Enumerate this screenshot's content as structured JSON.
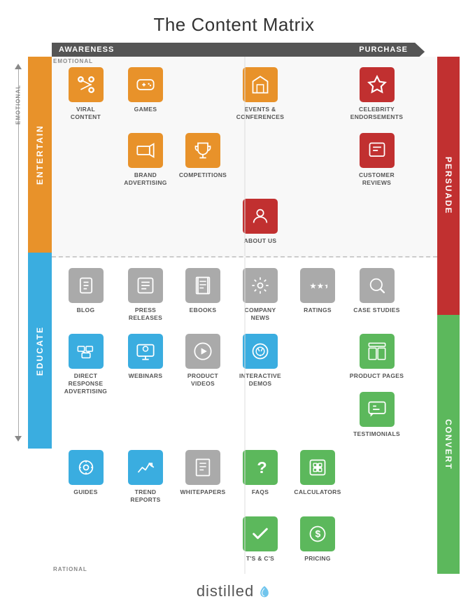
{
  "title": "The Content Matrix",
  "top_axis": {
    "left": "AWARENESS",
    "right": "PURCHASE"
  },
  "left_labels": {
    "top": "ENTERTAIN",
    "bottom": "EDUCATE"
  },
  "right_labels": {
    "top": "PERSUADE",
    "bottom": "CONVERT"
  },
  "vertical_axis": {
    "top": "EMOTIONAL",
    "bottom": "RATIONAL"
  },
  "top_items": [
    {
      "id": "viral-content",
      "label": "VIRAL CONTENT",
      "icon": "📢",
      "color": "c-orange",
      "col": 1,
      "row": 1
    },
    {
      "id": "games",
      "label": "GAMES",
      "icon": "🎮",
      "color": "c-orange",
      "col": 2,
      "row": 1
    },
    {
      "id": "events-conferences",
      "label": "EVENTS & CONFERENCES",
      "icon": "🎪",
      "color": "c-orange",
      "col": 3,
      "row": 1
    },
    {
      "id": "celebrity-endorsements",
      "label": "CELEBRITY ENDORSEMENTS",
      "icon": "⭐",
      "color": "c-red",
      "col": 5,
      "row": 1
    },
    {
      "id": "brand-advertising",
      "label": "BRAND ADVERTISING",
      "icon": "📺",
      "color": "c-orange",
      "col": 2,
      "row": 2
    },
    {
      "id": "competitions",
      "label": "COMPETITIONS",
      "icon": "🏆",
      "color": "c-orange",
      "col": 3,
      "row": 2
    },
    {
      "id": "customer-reviews",
      "label": "CUSTOMER REVIEWS",
      "icon": "📋",
      "color": "c-red",
      "col": 6,
      "row": 2
    },
    {
      "id": "about-us",
      "label": "ABOUT US",
      "icon": "👤",
      "color": "c-red",
      "col": 4,
      "row": 3
    }
  ],
  "bottom_items": [
    {
      "id": "blog",
      "label": "BLOG",
      "icon": "✏️",
      "color": "c-grey",
      "col": 1,
      "row": 1
    },
    {
      "id": "press-releases",
      "label": "PRESS RELEASES",
      "icon": "📰",
      "color": "c-grey",
      "col": 2,
      "row": 1
    },
    {
      "id": "ebooks",
      "label": "EBOOKS",
      "icon": "📖",
      "color": "c-grey",
      "col": 3,
      "row": 1
    },
    {
      "id": "company-news",
      "label": "COMPANY NEWS",
      "icon": "📡",
      "color": "c-grey",
      "col": 4,
      "row": 1
    },
    {
      "id": "ratings",
      "label": "RATINGS",
      "icon": "★",
      "color": "c-grey",
      "col": 5,
      "row": 1
    },
    {
      "id": "case-studies",
      "label": "CASE STUDIES",
      "icon": "🔍",
      "color": "c-grey",
      "col": 6,
      "row": 1
    },
    {
      "id": "direct-response",
      "label": "DIRECT RESPONSE ADVERTISING",
      "icon": "🔀",
      "color": "c-blue-bright",
      "col": 1,
      "row": 2
    },
    {
      "id": "webinars",
      "label": "WEBINARS",
      "icon": "🖥️",
      "color": "c-blue-bright",
      "col": 2,
      "row": 2
    },
    {
      "id": "product-videos",
      "label": "PRODUCT VIDEOS",
      "icon": "▶️",
      "color": "c-grey",
      "col": 3,
      "row": 2
    },
    {
      "id": "interactive-demos",
      "label": "INTERACTIVE DEMOS",
      "icon": "⚙️",
      "color": "c-blue-bright",
      "col": 4,
      "row": 2
    },
    {
      "id": "product-pages",
      "label": "PRODUCT PAGES",
      "icon": "▦",
      "color": "c-green-bright",
      "col": 6,
      "row": 2
    },
    {
      "id": "testimonials",
      "label": "TESTIMONIALS",
      "icon": "💬",
      "color": "c-green-bright",
      "col": 6,
      "row": 2
    },
    {
      "id": "guides",
      "label": "GUIDES",
      "icon": "🧭",
      "color": "c-blue-bright",
      "col": 1,
      "row": 3
    },
    {
      "id": "trend-reports",
      "label": "TREND REPORTS",
      "icon": "📈",
      "color": "c-blue-bright",
      "col": 2,
      "row": 3
    },
    {
      "id": "whitepapers",
      "label": "WHITEPAPERS",
      "icon": "📄",
      "color": "c-grey",
      "col": 3,
      "row": 3
    },
    {
      "id": "faqs",
      "label": "FAQs",
      "icon": "?",
      "color": "c-green-bright",
      "col": 4,
      "row": 3
    },
    {
      "id": "calculators",
      "label": "CALCULATORS",
      "icon": "⊞",
      "color": "c-green-bright",
      "col": 5,
      "row": 3
    },
    {
      "id": "ts-cs",
      "label": "T's & C's",
      "icon": "✔",
      "color": "c-green-bright",
      "col": 4,
      "row": 4
    },
    {
      "id": "pricing",
      "label": "PRICING",
      "icon": "$",
      "color": "c-green-bright",
      "col": 5,
      "row": 4
    }
  ],
  "footer": {
    "brand": "distilled",
    "tagline": ""
  }
}
